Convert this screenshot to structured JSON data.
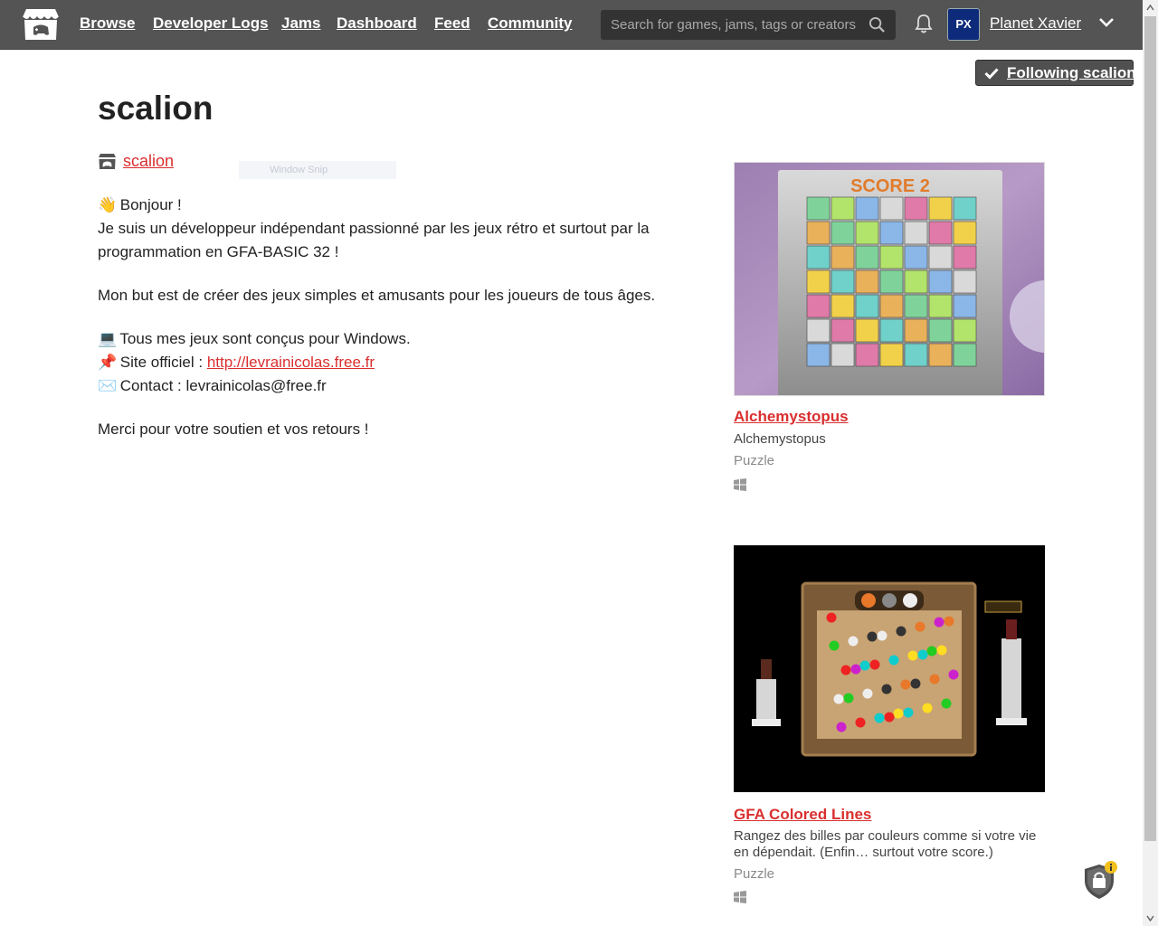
{
  "nav": {
    "links": [
      "Browse",
      "Developer Logs",
      "Jams",
      "Dashboard",
      "Feed",
      "Community"
    ],
    "search_placeholder": "Search for games, jams, tags or creators",
    "avatar_initials": "PX",
    "username": "Planet Xavier"
  },
  "follow_button": "Following scalion",
  "profile": {
    "name": "scalion",
    "user_link": "scalion",
    "overlay_text": "Window Snip"
  },
  "description": {
    "greeting_emoji": "👋",
    "greeting": "Bonjour !",
    "intro": "Je suis un développeur indépendant passionné par les jeux rétro et surtout par la programmation en GFA-BASIC 32 !",
    "goal": "Mon but est de créer des jeux simples et amusants pour les joueurs de tous âges.",
    "windows_emoji": "💻",
    "windows_line": "Tous mes jeux sont conçus pour Windows.",
    "site_emoji": "📌",
    "site_label": "Site officiel : ",
    "site_url": "http://levrainicolas.free.fr",
    "contact_emoji": "✉️",
    "contact_line": "Contact : levrainicolas@free.fr",
    "thanks": "Merci pour votre soutien et vos retours !"
  },
  "games": [
    {
      "title": "Alchemystopus",
      "subtitle": "Alchemystopus",
      "genre": "Puzzle",
      "platform_icon": "windows-icon",
      "thumb_score_text": "SCORE 2"
    },
    {
      "title": "GFA Colored Lines",
      "subtitle": "Rangez des billes par couleurs comme si votre vie en dépendait. (Enfin… surtout votre score.)",
      "genre": "Puzzle",
      "platform_icon": "windows-icon"
    }
  ],
  "colors": {
    "nav_bg": "#545454",
    "link_red": "#da2f2f",
    "follow_bg": "#505050"
  }
}
